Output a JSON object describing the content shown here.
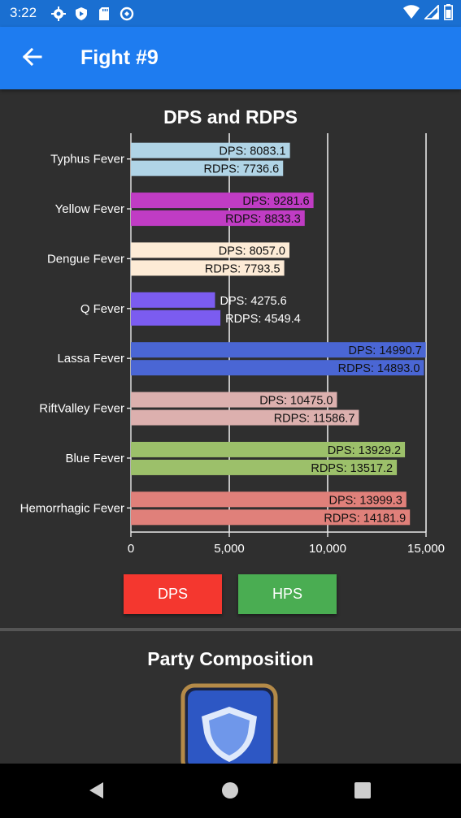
{
  "status_bar": {
    "time": "3:22",
    "icons_left": [
      "gear-icon",
      "shield-play-icon",
      "sd-card-icon",
      "sync-icon"
    ],
    "icons_right": [
      "wifi-icon",
      "cellular-signal-icon",
      "battery-icon"
    ]
  },
  "app_bar": {
    "title": "Fight #9",
    "back_icon": "arrow-left-icon"
  },
  "chart_data": {
    "type": "bar",
    "orientation": "horizontal",
    "title": "DPS and RDPS",
    "categories": [
      "Typhus Fever",
      "Yellow Fever",
      "Dengue Fever",
      "Q Fever",
      "Lassa Fever",
      "RiftValley Fever",
      "Blue Fever",
      "Hemorrhagic Fever"
    ],
    "series": [
      {
        "name": "DPS",
        "values": [
          8083.1,
          9281.6,
          8057.0,
          4275.6,
          14990.7,
          10475.0,
          13929.2,
          13999.3
        ]
      },
      {
        "name": "RDPS",
        "values": [
          7736.6,
          8833.3,
          7793.5,
          4549.4,
          14893.0,
          11586.7,
          13517.2,
          14181.9
        ]
      }
    ],
    "bar_labels": [
      [
        "DPS: 8083.1",
        "RDPS: 7736.6"
      ],
      [
        "DPS: 9281.6",
        "RDPS: 8833.3"
      ],
      [
        "DPS: 8057.0",
        "RDPS: 7793.5"
      ],
      [
        "DPS: 4275.6",
        "RDPS: 4549.4"
      ],
      [
        "DPS: 14990.7",
        "RDPS: 14893.0"
      ],
      [
        "DPS: 10475.0",
        "RDPS: 11586.7"
      ],
      [
        "DPS: 13929.2",
        "RDPS: 13517.2"
      ],
      [
        "DPS: 13999.3",
        "RDPS: 14181.9"
      ]
    ],
    "colors": [
      "#b0d4e6",
      "#c03cc4",
      "#fdebd6",
      "#7b5cf0",
      "#4a66d4",
      "#dcb0ae",
      "#9cc06a",
      "#e0807a"
    ],
    "xlim": [
      0,
      15000
    ],
    "xticks": [
      0,
      5000,
      10000,
      15000
    ],
    "xtick_labels": [
      "0",
      "5,000",
      "10,000",
      "15,000"
    ],
    "grid": true
  },
  "buttons": {
    "dps": {
      "label": "DPS",
      "color": "#f4372f"
    },
    "hps": {
      "label": "HPS",
      "color": "#4aad52"
    }
  },
  "party": {
    "title": "Party Composition",
    "icon": "shield-class-icon"
  },
  "nav_bar": {
    "icons": [
      "back-triangle-icon",
      "home-circle-icon",
      "recents-square-icon"
    ]
  }
}
